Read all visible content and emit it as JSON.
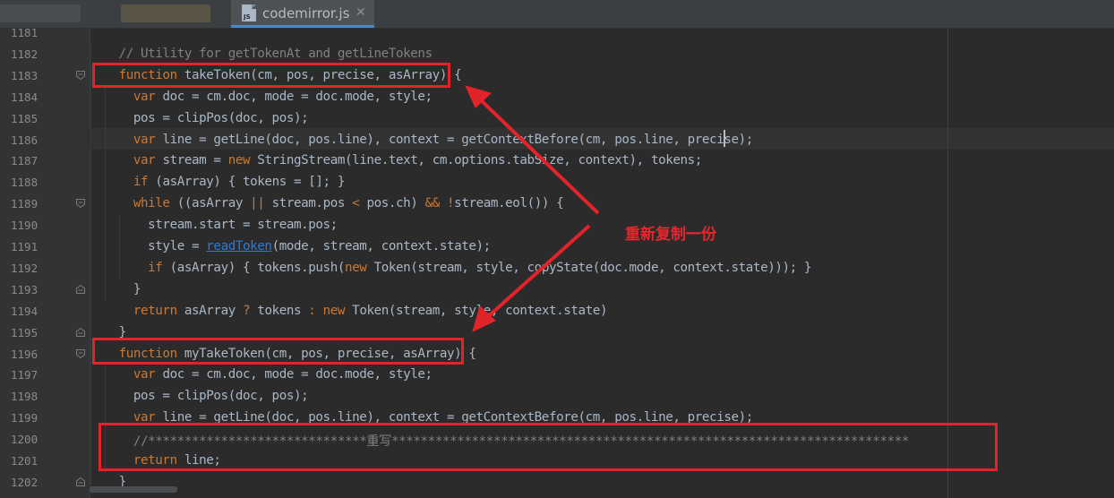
{
  "tab": {
    "file_name": "codemirror.js",
    "icon_label": "JS",
    "close_glyph": "✕"
  },
  "annotation": {
    "text": "重新复制一份"
  },
  "lines": [
    {
      "num": "1181",
      "parts": []
    },
    {
      "num": "1182",
      "parts": [
        [
          "    ",
          ""
        ],
        [
          "// Utility for getTokenAt and getLineTokens",
          "c"
        ]
      ]
    },
    {
      "num": "1183",
      "parts": [
        [
          "    ",
          ""
        ],
        [
          "function ",
          "k"
        ],
        [
          "takeToken(cm, pos, precise, asArray) {",
          ""
        ]
      ]
    },
    {
      "num": "1184",
      "parts": [
        [
          "      ",
          ""
        ],
        [
          "var ",
          "k"
        ],
        [
          "doc = cm.doc, mode = doc.mode, style;",
          ""
        ]
      ]
    },
    {
      "num": "1185",
      "parts": [
        [
          "      ",
          ""
        ],
        [
          "pos = clipPos(doc, pos);",
          ""
        ]
      ]
    },
    {
      "num": "1186",
      "parts": [
        [
          "      ",
          ""
        ],
        [
          "var ",
          "k"
        ],
        [
          "line = getLine(doc, pos.line), context = getContextBefore(cm, pos.line, precise);",
          ""
        ]
      ]
    },
    {
      "num": "1187",
      "parts": [
        [
          "      ",
          ""
        ],
        [
          "var ",
          "k"
        ],
        [
          "stream = ",
          ""
        ],
        [
          "new ",
          "k"
        ],
        [
          "StringStream(line.text, cm.options.tabSize, context), tokens;",
          ""
        ]
      ]
    },
    {
      "num": "1188",
      "parts": [
        [
          "      ",
          ""
        ],
        [
          "if ",
          "k"
        ],
        [
          "(asArray) { tokens = []; }",
          ""
        ]
      ]
    },
    {
      "num": "1189",
      "parts": [
        [
          "      ",
          ""
        ],
        [
          "while ",
          "k"
        ],
        [
          "((asArray ",
          ""
        ],
        [
          "|| ",
          "k"
        ],
        [
          "stream.pos ",
          ""
        ],
        [
          "< ",
          "k"
        ],
        [
          "pos.ch) ",
          ""
        ],
        [
          "&& ",
          "k"
        ],
        [
          "!",
          "k"
        ],
        [
          "stream.eol()) {",
          ""
        ]
      ]
    },
    {
      "num": "1190",
      "parts": [
        [
          "        ",
          ""
        ],
        [
          "stream.start = stream.pos;",
          ""
        ]
      ]
    },
    {
      "num": "1191",
      "parts": [
        [
          "        ",
          ""
        ],
        [
          "style = ",
          ""
        ],
        [
          "readToken",
          "u"
        ],
        [
          "(mode, stream, context.state);",
          ""
        ]
      ]
    },
    {
      "num": "1192",
      "parts": [
        [
          "        ",
          ""
        ],
        [
          "if ",
          "k"
        ],
        [
          "(asArray) { tokens.push(",
          ""
        ],
        [
          "new ",
          "k"
        ],
        [
          "Token(stream, style, copyState(doc.mode, context.state))); }",
          ""
        ]
      ]
    },
    {
      "num": "1193",
      "parts": [
        [
          "      ",
          ""
        ],
        [
          "}",
          ""
        ]
      ]
    },
    {
      "num": "1194",
      "parts": [
        [
          "      ",
          ""
        ],
        [
          "return ",
          "k"
        ],
        [
          "asArray ",
          ""
        ],
        [
          "? ",
          "k"
        ],
        [
          "tokens ",
          ""
        ],
        [
          ": ",
          "k"
        ],
        [
          "new ",
          "k"
        ],
        [
          "Token(stream, style, context.state)",
          ""
        ]
      ]
    },
    {
      "num": "1195",
      "parts": [
        [
          "    ",
          ""
        ],
        [
          "}",
          ""
        ]
      ]
    },
    {
      "num": "1196",
      "parts": [
        [
          "    ",
          ""
        ],
        [
          "function ",
          "k"
        ],
        [
          "myTakeToken(cm, pos, precise, asArray) {",
          ""
        ]
      ]
    },
    {
      "num": "1197",
      "parts": [
        [
          "      ",
          ""
        ],
        [
          "var ",
          "k"
        ],
        [
          "doc = cm.doc, mode = doc.mode, style;",
          ""
        ]
      ]
    },
    {
      "num": "1198",
      "parts": [
        [
          "      ",
          ""
        ],
        [
          "pos = clipPos(doc, pos);",
          ""
        ]
      ]
    },
    {
      "num": "1199",
      "parts": [
        [
          "      ",
          ""
        ],
        [
          "var ",
          "k"
        ],
        [
          "line = getLine(doc, pos.line), context = getContextBefore(cm, pos.line, precise);",
          ""
        ]
      ]
    },
    {
      "num": "1200",
      "parts": [
        [
          "      ",
          ""
        ],
        [
          "//******************************重写***********************************************************************",
          "c"
        ]
      ]
    },
    {
      "num": "1201",
      "parts": [
        [
          "      ",
          ""
        ],
        [
          "return ",
          "k"
        ],
        [
          "line;",
          ""
        ]
      ]
    },
    {
      "num": "1202",
      "parts": [
        [
          "    ",
          ""
        ],
        [
          "}",
          ""
        ]
      ]
    }
  ],
  "folds": {
    "open_lines": [
      "1183",
      "1189",
      "1196"
    ],
    "close_lines": [
      "1193",
      "1195",
      "1202"
    ]
  }
}
